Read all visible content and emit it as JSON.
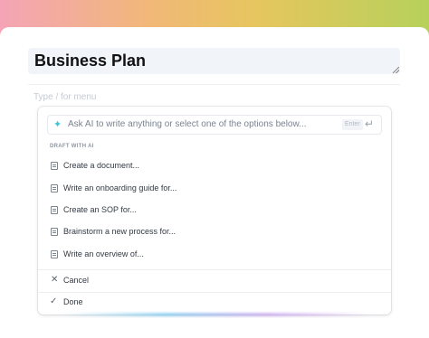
{
  "document": {
    "title": "Business Plan",
    "hint": "Type / for menu"
  },
  "ai_menu": {
    "input_placeholder": "Ask AI to write anything or select one of the options below...",
    "enter_label": "Enter",
    "section_label": "DRAFT WITH AI",
    "items": [
      {
        "label": "Create a document..."
      },
      {
        "label": "Write an onboarding guide for..."
      },
      {
        "label": "Create an SOP for..."
      },
      {
        "label": "Brainstorm a new process for..."
      },
      {
        "label": "Write an overview of..."
      }
    ],
    "cancel_label": "Cancel",
    "done_label": "Done"
  },
  "icons": {
    "sparkle": "sparkle-icon",
    "enter": "enter-arrow-icon",
    "item": "document-icon",
    "cancel": "close-icon",
    "done": "check-icon"
  },
  "colors": {
    "accent": "#3cc3d6",
    "title_bg": "#f1f4f8"
  }
}
